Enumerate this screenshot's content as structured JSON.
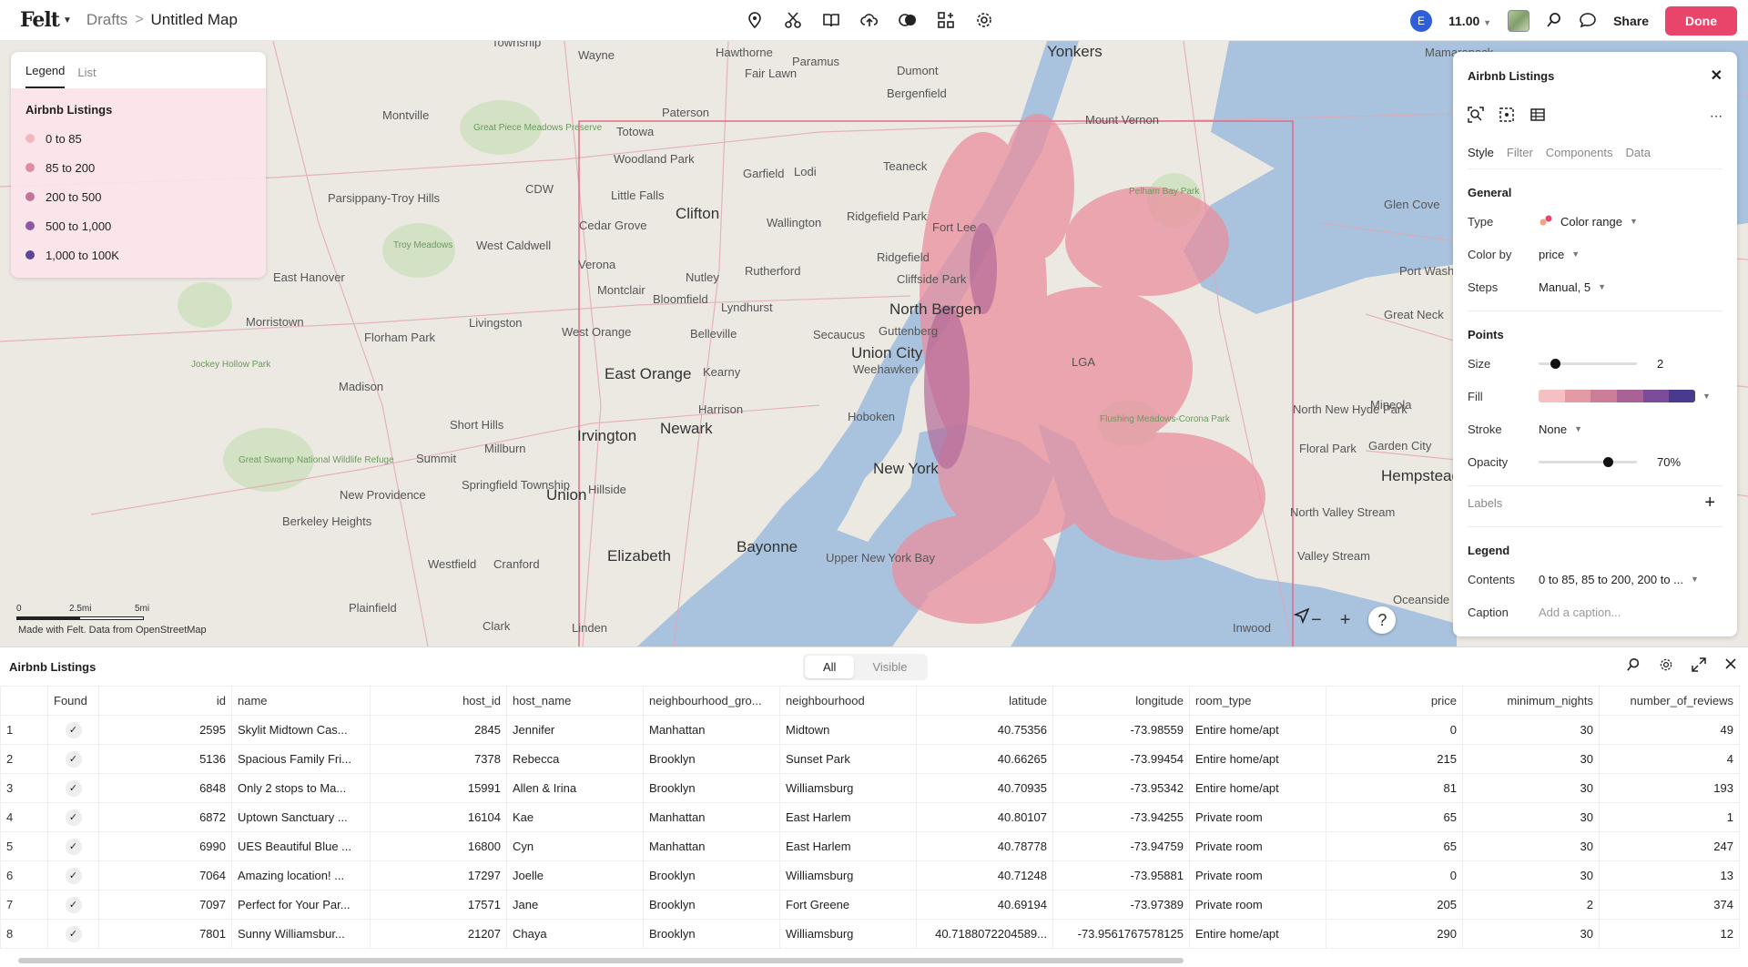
{
  "header": {
    "logo": "Felt",
    "breadcrumb_parent": "Drafts",
    "breadcrumb_sep": ">",
    "map_title": "Untitled Map",
    "avatar_initial": "E",
    "zoom": "11.00",
    "share": "Share",
    "done": "Done"
  },
  "map": {
    "places": [
      "Wayne",
      "Hawthorne",
      "Paramus",
      "Dumont",
      "Yonkers",
      "Mamaroneck",
      "Township",
      "Fair Lawn",
      "Bergenfield",
      "Montville",
      "Paterson",
      "Mount Vernon",
      "Great Piece Meadows Preserve",
      "Totowa",
      "Woodland Park",
      "Garfield",
      "Lodi",
      "Teaneck",
      "Parsippany-Troy Hills",
      "Little Falls",
      "Cedar Grove",
      "Clifton",
      "Wallington",
      "Ridgefield Park",
      "Fort Lee",
      "Glen Cove",
      "East Hanover",
      "CDW",
      "West Caldwell",
      "Troy Meadows",
      "Verona",
      "Nutley",
      "Rutherford",
      "Ridgefield",
      "Cliffside Park",
      "Port Washington",
      "Morristown",
      "Florham Park",
      "Livingston",
      "Montclair",
      "Bloomfield",
      "Lyndhurst",
      "North Bergen",
      "Great Neck",
      "West Orange",
      "Belleville",
      "Secaucus",
      "Guttenberg",
      "Jockey Hollow Park",
      "Madison",
      "East Orange",
      "Kearny",
      "Union City",
      "Weehawken",
      "LGA",
      "Mineola",
      "Harrison",
      "Hoboken",
      "North New Hyde Park",
      "Short Hills",
      "Newark",
      "Irvington",
      "Millburn",
      "Floral Park",
      "Garden City",
      "Summit",
      "Great Swamp National Wildlife Refuge",
      "New York",
      "Flushing Meadows-Corona Park",
      "Springfield Township",
      "Union",
      "Hillside",
      "Hempstead",
      "New Providence",
      "North Valley Stream",
      "Berkeley Heights",
      "Elizabeth",
      "Bayonne",
      "Upper New York Bay",
      "Valley Stream",
      "Westfield",
      "Cranford",
      "Oceanside",
      "Plainfield",
      "Clark",
      "Linden",
      "Inwood",
      "Pelham Bay Park"
    ],
    "scale_labels": [
      "0",
      "2.5mi",
      "5mi"
    ],
    "attribution": "Made with Felt. Data from OpenStreetMap",
    "zoom_out": "−",
    "zoom_in": "+",
    "help": "?"
  },
  "legend": {
    "tabs": [
      "Legend",
      "List"
    ],
    "title": "Airbnb Listings",
    "items": [
      {
        "label": "0 to 85",
        "color": "#f4b6bf"
      },
      {
        "label": "85 to 200",
        "color": "#dd8ea0"
      },
      {
        "label": "200 to 500",
        "color": "#c17597"
      },
      {
        "label": "500 to 1,000",
        "color": "#8c5a9e"
      },
      {
        "label": "1,000 to 100K",
        "color": "#5a4694"
      }
    ]
  },
  "panel": {
    "title": "Airbnb Listings",
    "close": "✕",
    "more": "⋯",
    "tabs": [
      "Style",
      "Filter",
      "Components",
      "Data"
    ],
    "general_title": "General",
    "type_label": "Type",
    "type_value": "Color range",
    "colorby_label": "Color by",
    "colorby_value": "price",
    "steps_label": "Steps",
    "steps_value": "Manual, 5",
    "points_title": "Points",
    "size_label": "Size",
    "size_value": "2",
    "size_fraction": 0.12,
    "fill_label": "Fill",
    "fill_colors": [
      "#f6bfc2",
      "#e49aa5",
      "#cc7d98",
      "#a96295",
      "#7b4c99",
      "#4a3a8e"
    ],
    "stroke_label": "Stroke",
    "stroke_value": "None",
    "opacity_label": "Opacity",
    "opacity_value": "70%",
    "opacity_fraction": 0.7,
    "labels_label": "Labels",
    "labels_add": "+",
    "legend_title": "Legend",
    "contents_label": "Contents",
    "contents_value": "0 to 85, 85 to 200, 200 to ...",
    "caption_label": "Caption",
    "caption_placeholder": "Add a caption..."
  },
  "table": {
    "title": "Airbnb Listings",
    "seg_all": "All",
    "seg_visible": "Visible",
    "columns": [
      "",
      "Found",
      "id",
      "name",
      "host_id",
      "host_name",
      "neighbourhood_gro...",
      "neighbourhood",
      "latitude",
      "longitude",
      "room_type",
      "price",
      "minimum_nights",
      "number_of_reviews"
    ],
    "rows": [
      [
        "1",
        "✓",
        "2595",
        "Skylit Midtown Cas...",
        "2845",
        "Jennifer",
        "Manhattan",
        "Midtown",
        "40.75356",
        "-73.98559",
        "Entire home/apt",
        "0",
        "30",
        "49"
      ],
      [
        "2",
        "✓",
        "5136",
        "Spacious Family Fri...",
        "7378",
        "Rebecca",
        "Brooklyn",
        "Sunset Park",
        "40.66265",
        "-73.99454",
        "Entire home/apt",
        "215",
        "30",
        "4"
      ],
      [
        "3",
        "✓",
        "6848",
        "Only 2 stops to Ma...",
        "15991",
        "Allen & Irina",
        "Brooklyn",
        "Williamsburg",
        "40.70935",
        "-73.95342",
        "Entire home/apt",
        "81",
        "30",
        "193"
      ],
      [
        "4",
        "✓",
        "6872",
        "Uptown Sanctuary ...",
        "16104",
        "Kae",
        "Manhattan",
        "East Harlem",
        "40.80107",
        "-73.94255",
        "Private room",
        "65",
        "30",
        "1"
      ],
      [
        "5",
        "✓",
        "6990",
        "UES Beautiful Blue ...",
        "16800",
        "Cyn",
        "Manhattan",
        "East Harlem",
        "40.78778",
        "-73.94759",
        "Private room",
        "65",
        "30",
        "247"
      ],
      [
        "6",
        "✓",
        "7064",
        "Amazing location! ...",
        "17297",
        "Joelle",
        "Brooklyn",
        "Williamsburg",
        "40.71248",
        "-73.95881",
        "Private room",
        "0",
        "30",
        "13"
      ],
      [
        "7",
        "✓",
        "7097",
        "Perfect for Your Par...",
        "17571",
        "Jane",
        "Brooklyn",
        "Fort Greene",
        "40.69194",
        "-73.97389",
        "Private room",
        "205",
        "2",
        "374"
      ],
      [
        "8",
        "✓",
        "7801",
        "Sunny Williamsbur...",
        "21207",
        "Chaya",
        "Brooklyn",
        "Williamsburg",
        "40.7188072204589...",
        "-73.9561767578125",
        "Entire home/apt",
        "290",
        "30",
        "12"
      ]
    ]
  }
}
